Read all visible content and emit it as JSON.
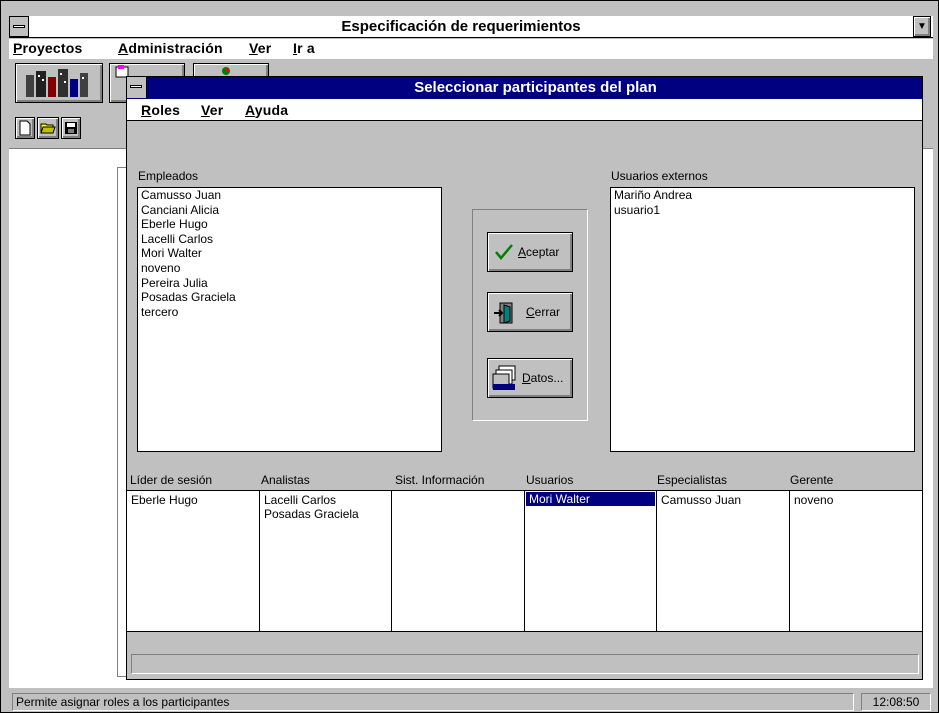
{
  "main_window": {
    "title": "Especificación de requerimientos",
    "menu": [
      {
        "label": "Proyectos",
        "key": "P",
        "rest": "royectos"
      },
      {
        "label": "Administración",
        "key": "A",
        "rest": "dministración"
      },
      {
        "label": "Ver",
        "key": "V",
        "rest": "er"
      },
      {
        "label": "Ir a",
        "key": "I",
        "rest": "r a"
      }
    ]
  },
  "dialog": {
    "title": "Seleccionar participantes del plan",
    "menu": [
      {
        "label": "Roles",
        "key": "R",
        "rest": "oles"
      },
      {
        "label": "Ver",
        "key": "V",
        "rest": "er"
      },
      {
        "label": "Ayuda",
        "key": "A",
        "rest": "yuda"
      }
    ],
    "empleados_label": "Empleados",
    "empleados": [
      "Camusso Juan",
      "Canciani Alicia",
      "Eberle Hugo",
      "Lacelli Carlos",
      "Mori Walter",
      "noveno",
      "Pereira Julia",
      "Posadas Graciela",
      "tercero"
    ],
    "externos_label": "Usuarios externos",
    "externos": [
      "Mariño Andrea",
      "usuario1"
    ],
    "buttons": {
      "aceptar": {
        "key": "A",
        "rest": "ceptar"
      },
      "cerrar": {
        "key": "C",
        "rest": "errar"
      },
      "datos": {
        "key": "D",
        "rest": "atos..."
      }
    },
    "roles_headers": [
      "Líder de sesión",
      "Analistas",
      "Sist. Información",
      "Usuarios",
      "Especialistas",
      "Gerente"
    ],
    "roles_values": [
      [
        "Eberle Hugo"
      ],
      [
        "Lacelli Carlos",
        "Posadas Graciela"
      ],
      [],
      [
        "Mori Walter"
      ],
      [
        "Camusso Juan"
      ],
      [
        "noveno"
      ]
    ]
  },
  "status_bar": {
    "message": "Permite asignar roles a los participantes",
    "time": "12:08:50"
  },
  "colors": {
    "title_active": "#000080",
    "face": "#c0c0c0",
    "selection": "#000080"
  }
}
